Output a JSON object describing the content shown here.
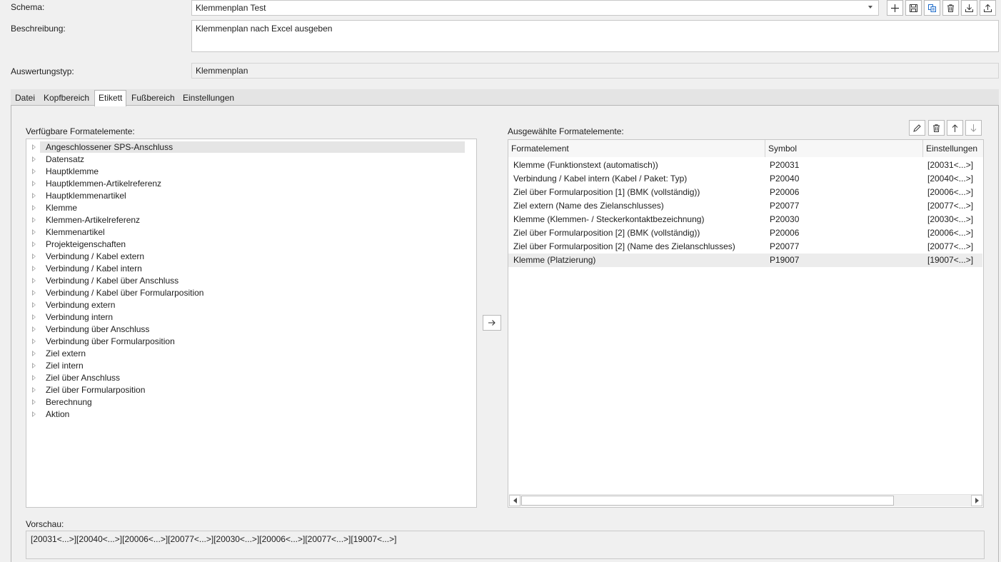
{
  "header": {
    "schema_label": "Schema:",
    "schema_value": "Klemmenplan Test",
    "description_label": "Beschreibung:",
    "description_value": "Klemmenplan nach Excel ausgeben",
    "type_label": "Auswertungstyp:",
    "type_value": "Klemmenplan"
  },
  "toolbar": {
    "icons": [
      "plus-icon",
      "save-icon",
      "copy-icon",
      "delete-icon",
      "import-icon",
      "export-icon"
    ]
  },
  "tabs": [
    {
      "label": "Datei"
    },
    {
      "label": "Kopfbereich"
    },
    {
      "label": "Etikett"
    },
    {
      "label": "Fußbereich"
    },
    {
      "label": "Einstellungen"
    }
  ],
  "active_tab": "Etikett",
  "available": {
    "label": "Verfügbare Formatelemente:",
    "items": [
      "Angeschlossener SPS-Anschluss",
      "Datensatz",
      "Hauptklemme",
      "Hauptklemmen-Artikelreferenz",
      "Hauptklemmenartikel",
      "Klemme",
      "Klemmen-Artikelreferenz",
      "Klemmenartikel",
      "Projekteigenschaften",
      "Verbindung / Kabel extern",
      "Verbindung / Kabel intern",
      "Verbindung / Kabel über Anschluss",
      "Verbindung / Kabel über Formularposition",
      "Verbindung extern",
      "Verbindung intern",
      "Verbindung über Anschluss",
      "Verbindung über Formularposition",
      "Ziel extern",
      "Ziel intern",
      "Ziel über Anschluss",
      "Ziel über Formularposition",
      "Berechnung",
      "Aktion"
    ],
    "selected_index": 0
  },
  "selected": {
    "label": "Ausgewählte Formatelemente:",
    "columns": [
      "Formatelement",
      "Symbol",
      "Einstellungen"
    ],
    "rows": [
      [
        "Klemme (Funktionstext (automatisch))",
        "P20031",
        "[20031<...>]"
      ],
      [
        "Verbindung / Kabel intern (Kabel / Paket: Typ)",
        "P20040",
        "[20040<...>]"
      ],
      [
        "Ziel über Formularposition [1] (BMK (vollständig))",
        "P20006",
        "[20006<...>]"
      ],
      [
        "Ziel extern (Name des Zielanschlusses)",
        "P20077",
        "[20077<...>]"
      ],
      [
        "Klemme (Klemmen- / Steckerkontaktbezeichnung)",
        "P20030",
        "[20030<...>]"
      ],
      [
        "Ziel über Formularposition [2] (BMK (vollständig))",
        "P20006",
        "[20006<...>]"
      ],
      [
        "Ziel über Formularposition [2] (Name des Zielanschlusses)",
        "P20077",
        "[20077<...>]"
      ],
      [
        "Klemme (Platzierung)",
        "P19007",
        "[19007<...>]"
      ]
    ],
    "selected_index": 7
  },
  "preview": {
    "label": "Vorschau:",
    "value": "[20031<...>][20040<...>][20006<...>][20077<...>][20030<...>][20006<...>][20077<...>][19007<...>]"
  }
}
